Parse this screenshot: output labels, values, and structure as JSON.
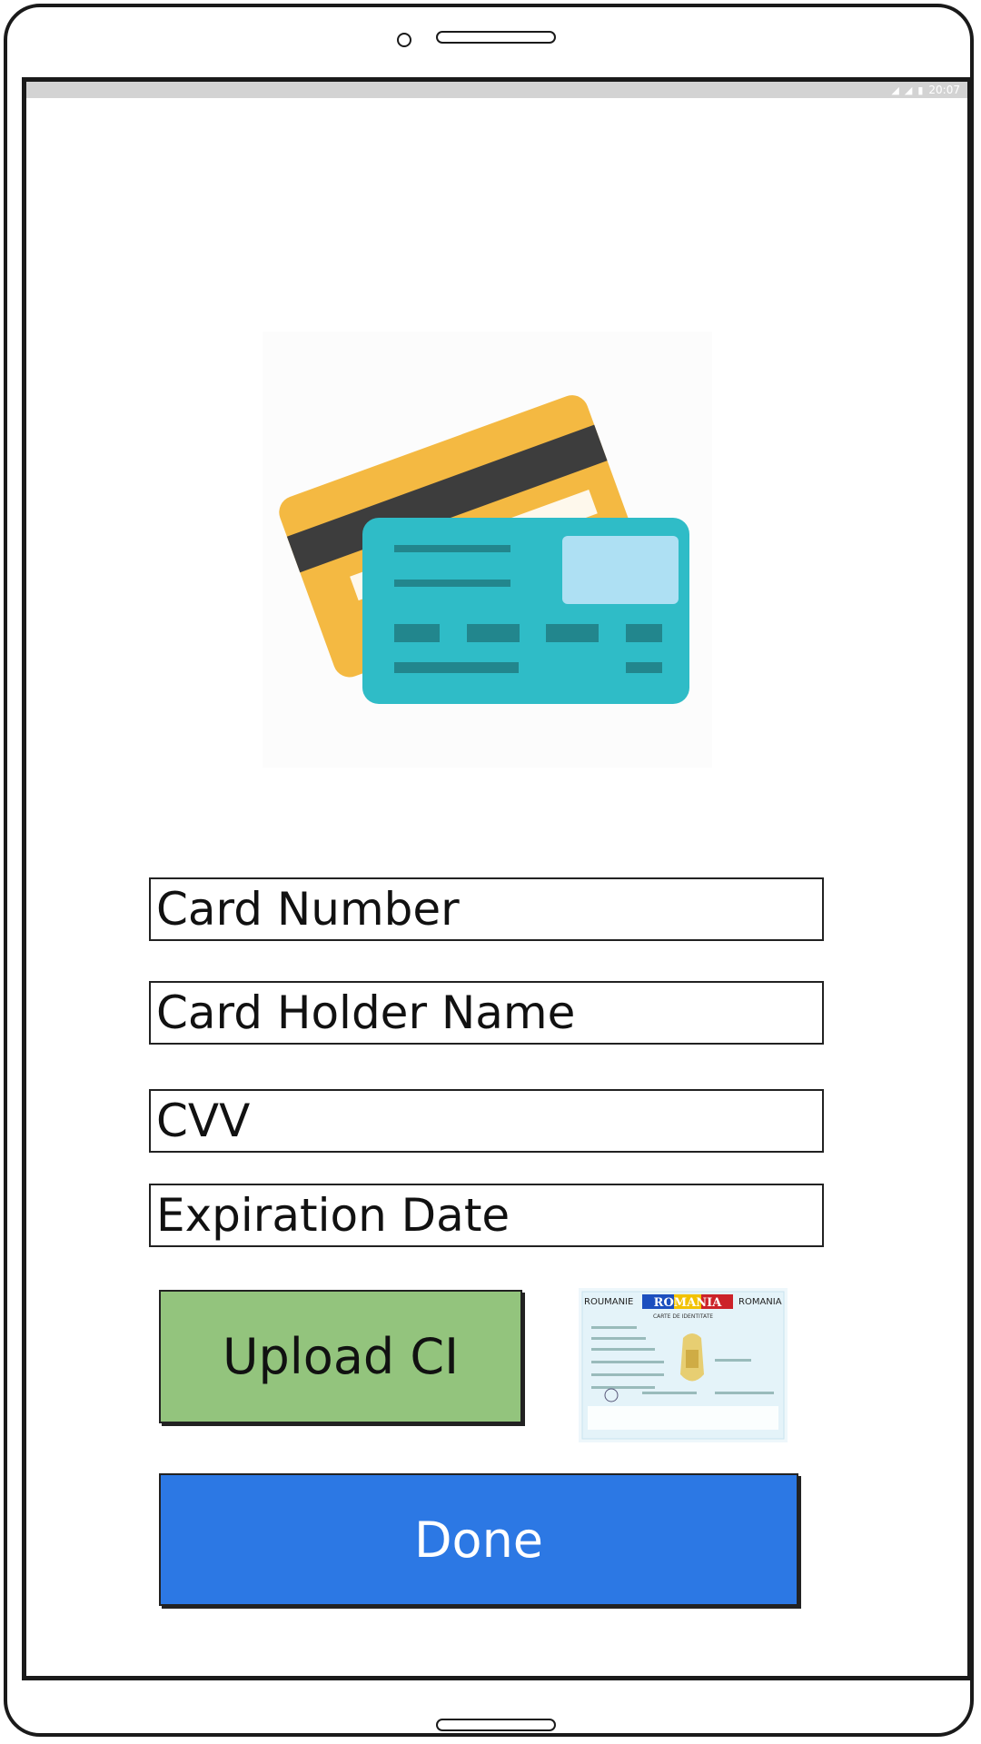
{
  "status_bar": {
    "time": "20:07"
  },
  "icons": {
    "hero": "credit-cards-icon",
    "wifi": "wifi-icon",
    "signal": "signal-icon",
    "battery": "battery-icon"
  },
  "form": {
    "card_number_placeholder": "Card Number",
    "card_holder_placeholder": "Card Holder Name",
    "cvv_placeholder": "CVV",
    "expiration_placeholder": "Expiration Date"
  },
  "upload": {
    "label": "Upload CI",
    "id_card_header_left": "ROUMANIE",
    "id_card_header_center": "ROMANIA",
    "id_card_header_right": "ROMANIA",
    "id_card_subtitle": "CARTE DE IDENTITATE"
  },
  "actions": {
    "done_label": "Done"
  },
  "colors": {
    "upload_button": "#93c47d",
    "done_button": "#2c78e4",
    "card_back": "#f4b942",
    "card_front": "#2fbcc7"
  }
}
